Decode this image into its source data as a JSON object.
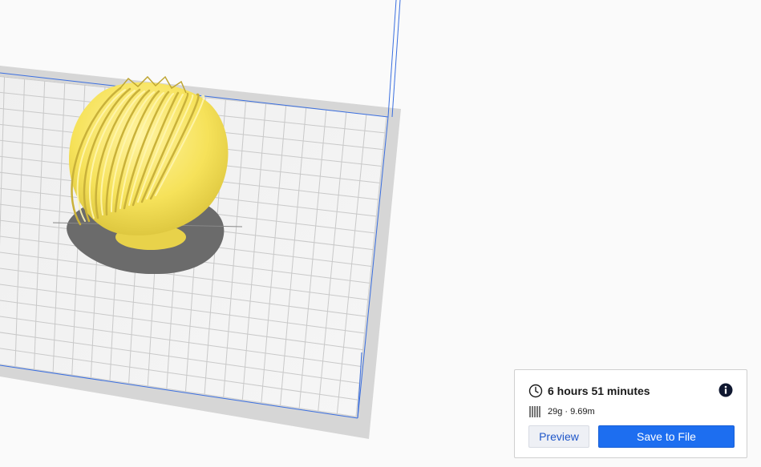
{
  "print_panel": {
    "time_icon": "clock-icon",
    "time": "6 hours 51 minutes",
    "info_icon": "info-circle-icon",
    "material_icon": "filament-spool-icon",
    "material": "29g · 9.69m",
    "preview_label": "Preview",
    "save_label": "Save to File"
  },
  "colors": {
    "viewport_background": "#fafafa",
    "build_plate": "#f2f2f2",
    "plate_grid": "#c8c8c8",
    "plate_border": "#d0d0d0",
    "build_volume_lines": "#3b6fe0",
    "model": "#f6e25a",
    "model_shadow": "#6a6a6a",
    "accent_button": "#1d6ef0",
    "preview_text": "#1f56c9"
  },
  "model": {
    "selected": false
  }
}
